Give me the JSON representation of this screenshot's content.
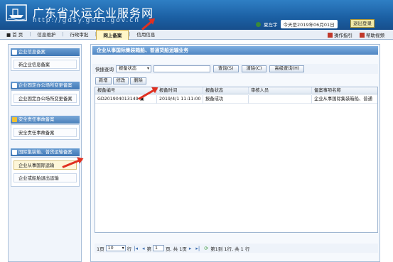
{
  "header": {
    "title": "广东省水运企业服务网",
    "url": "http://gdsy.gdcd.gov.cn",
    "user": "夏左宇",
    "date_text": "今天是2019年06月01日",
    "logout_label": "退出登录"
  },
  "nav": {
    "items": [
      {
        "label": "首 页",
        "icon": "home-icon"
      },
      {
        "label": "信息维护"
      },
      {
        "label": "行政审批"
      },
      {
        "label": "网上备案",
        "active": true
      },
      {
        "label": "信用信息"
      }
    ],
    "right": [
      {
        "label": "操作指引",
        "icon": "guide-icon"
      },
      {
        "label": "帮助视频",
        "icon": "video-icon"
      }
    ]
  },
  "sidebar": {
    "sections": [
      {
        "title": "企业信息备案",
        "items": [
          "新企业信息备案"
        ]
      },
      {
        "title": "企业固定办公场所变更备案",
        "items": [
          "企业固定办公场所变更备案"
        ]
      },
      {
        "title": "安全责任事故备案",
        "items": [
          "安全责任事故备案"
        ]
      },
      {
        "title": "国际集装箱、普货运输备案",
        "items": [
          "企业从事国际运输",
          "企业或船舶退出运输"
        ]
      }
    ]
  },
  "main": {
    "title": "企业从事国际集装箱船、普通货船运输业务",
    "query": {
      "label": "快捷查询",
      "select_value": "报备状态",
      "input_value": "",
      "search_label": "查询(S)",
      "clear_label": "清除(C)",
      "advanced_label": "高级查询(H)"
    },
    "toolbar": {
      "new_label": "新增",
      "edit_label": "修改",
      "delete_label": "删除"
    },
    "table": {
      "headers": [
        "报备编号",
        "报备时间",
        "报备状态",
        "审核人员",
        "备案事项名称"
      ],
      "rows": [
        [
          "GD201904013149",
          "2019/4/1 11:11:00",
          "报备成功",
          "",
          "企业从事国际集装箱船、普通"
        ]
      ]
    },
    "pager": {
      "page_prefix": "1页",
      "page_size": "10",
      "page_size_suffix": "行",
      "page_label_pre": "第",
      "page_value": "1",
      "page_label_post": "页, 共 1页",
      "summary": "第1到 1行, 共 1 行"
    }
  },
  "colors": {
    "header_bg": "#1b5fa3",
    "active_tab": "#fff6c8",
    "annotation_arrow": "#e03020"
  }
}
